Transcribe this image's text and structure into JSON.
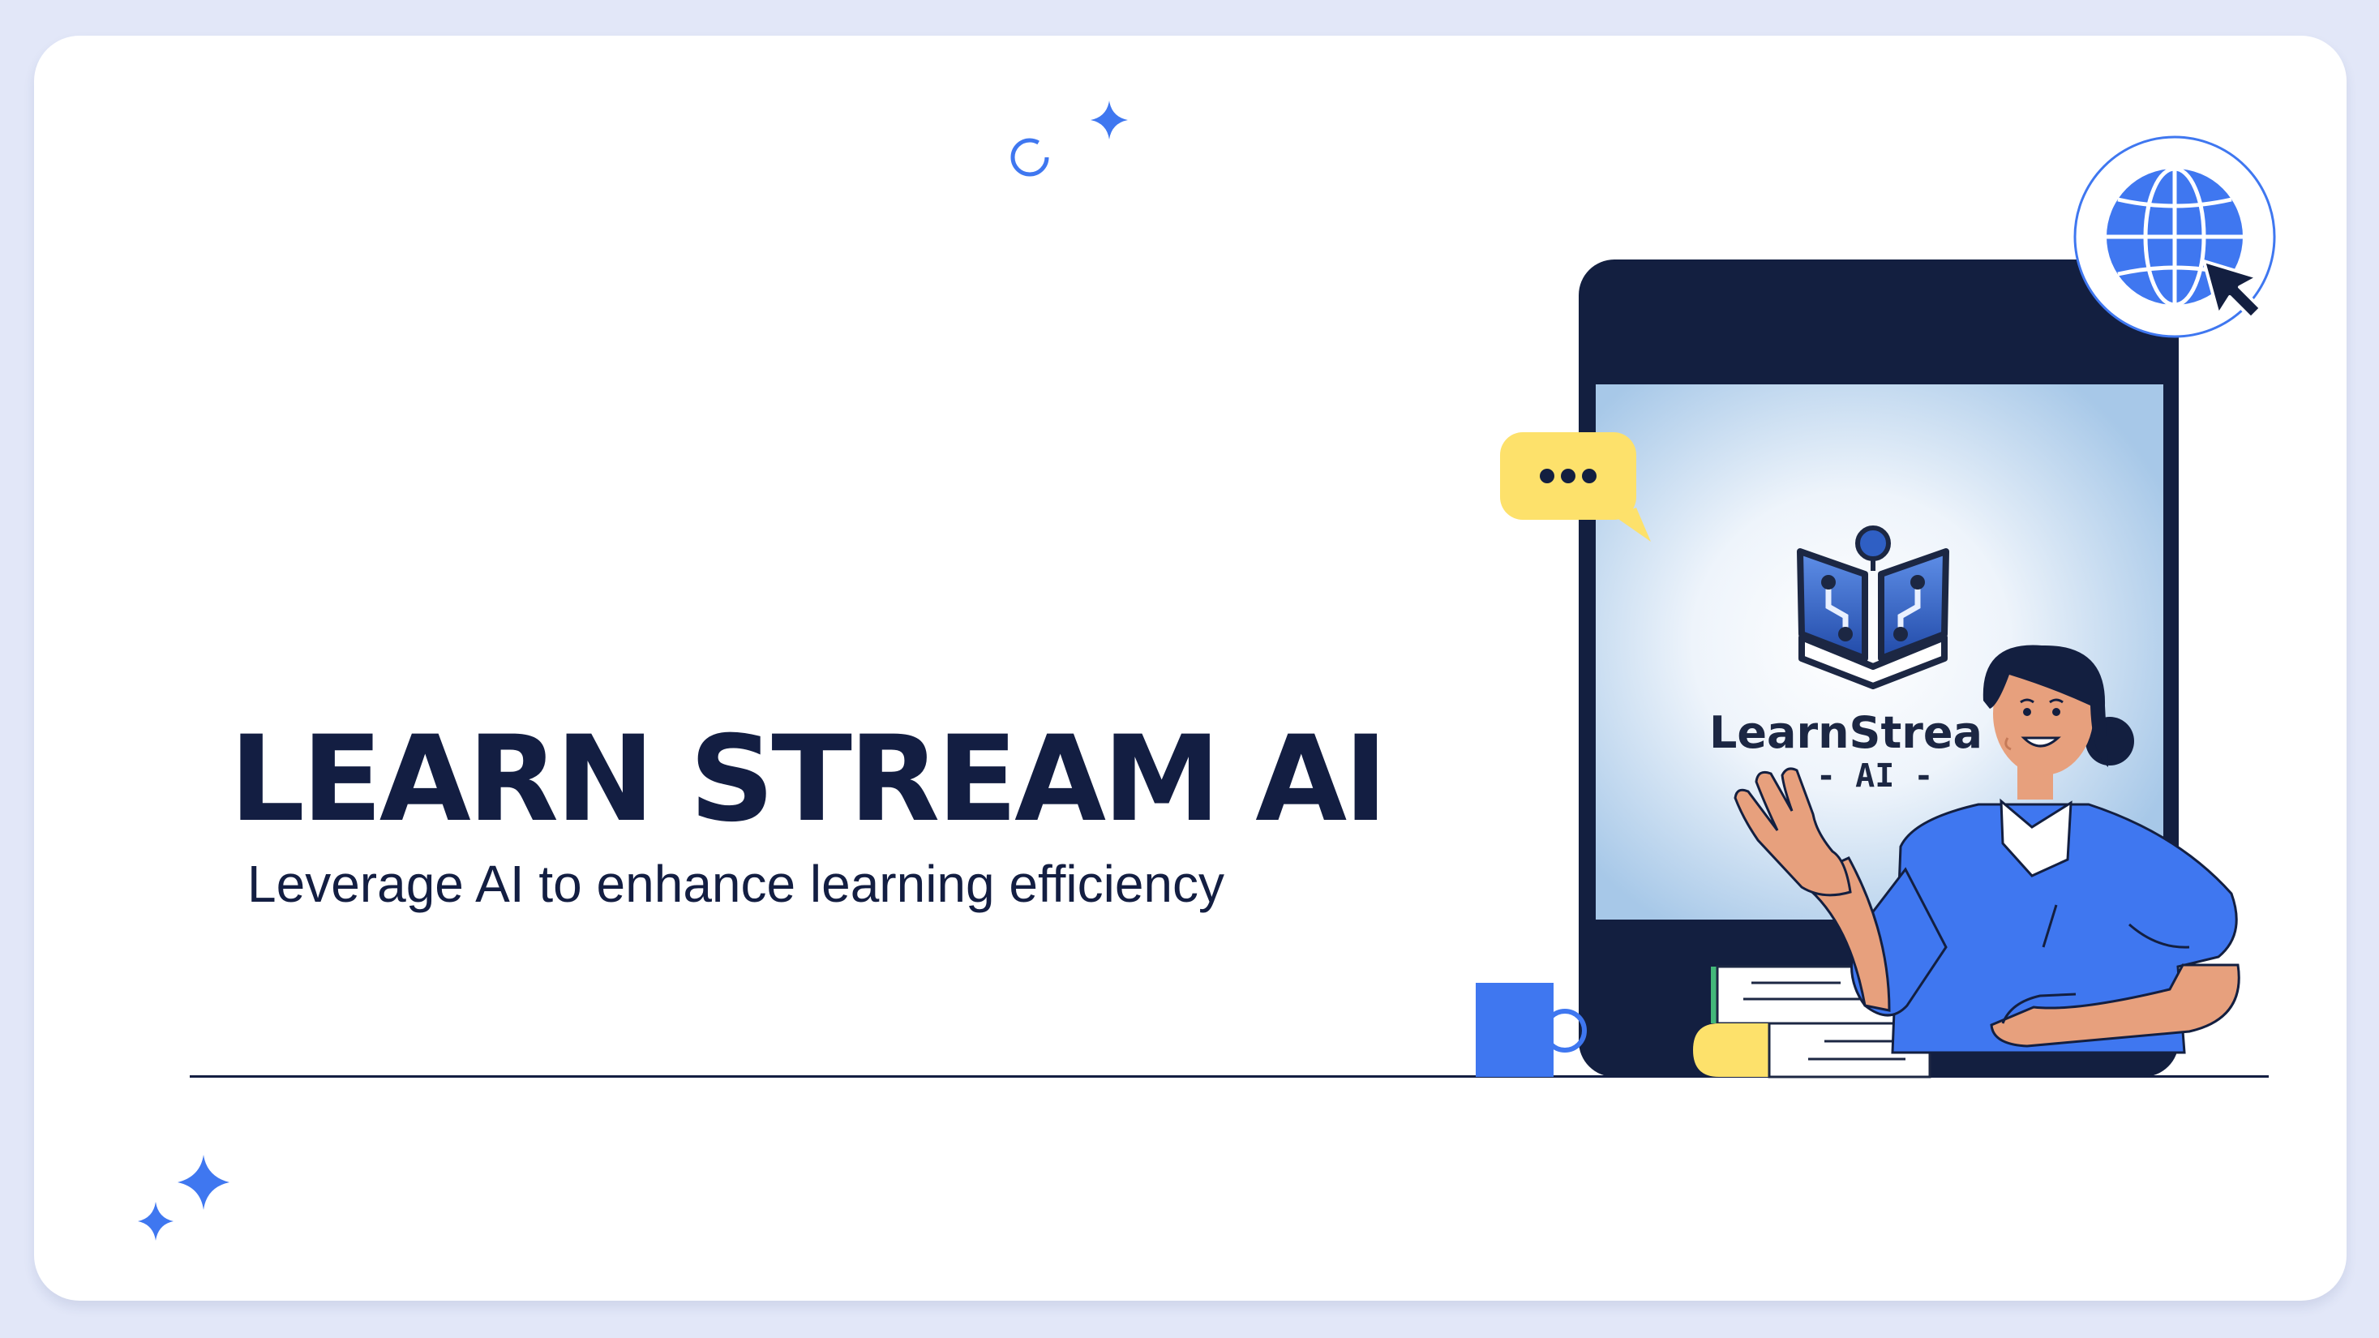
{
  "hero": {
    "title": "LEARN STREAM AI",
    "tagline": "Leverage AI to enhance learning efficiency"
  },
  "screen_logo": {
    "name": "LearnStrea",
    "sub": "- AI -"
  },
  "colors": {
    "page_background": "#e2e7f8",
    "card": "#ffffff",
    "navy": "#131e42",
    "accent_blue": "#3f77f0",
    "bubble_yellow": "#fde16b",
    "skin": "#e7a07d"
  },
  "icons": [
    "sparkle-icon",
    "loader-ring-icon",
    "globe-icon",
    "cursor-icon",
    "chat-bubble-icon",
    "book-logo-icon",
    "mug-icon"
  ]
}
